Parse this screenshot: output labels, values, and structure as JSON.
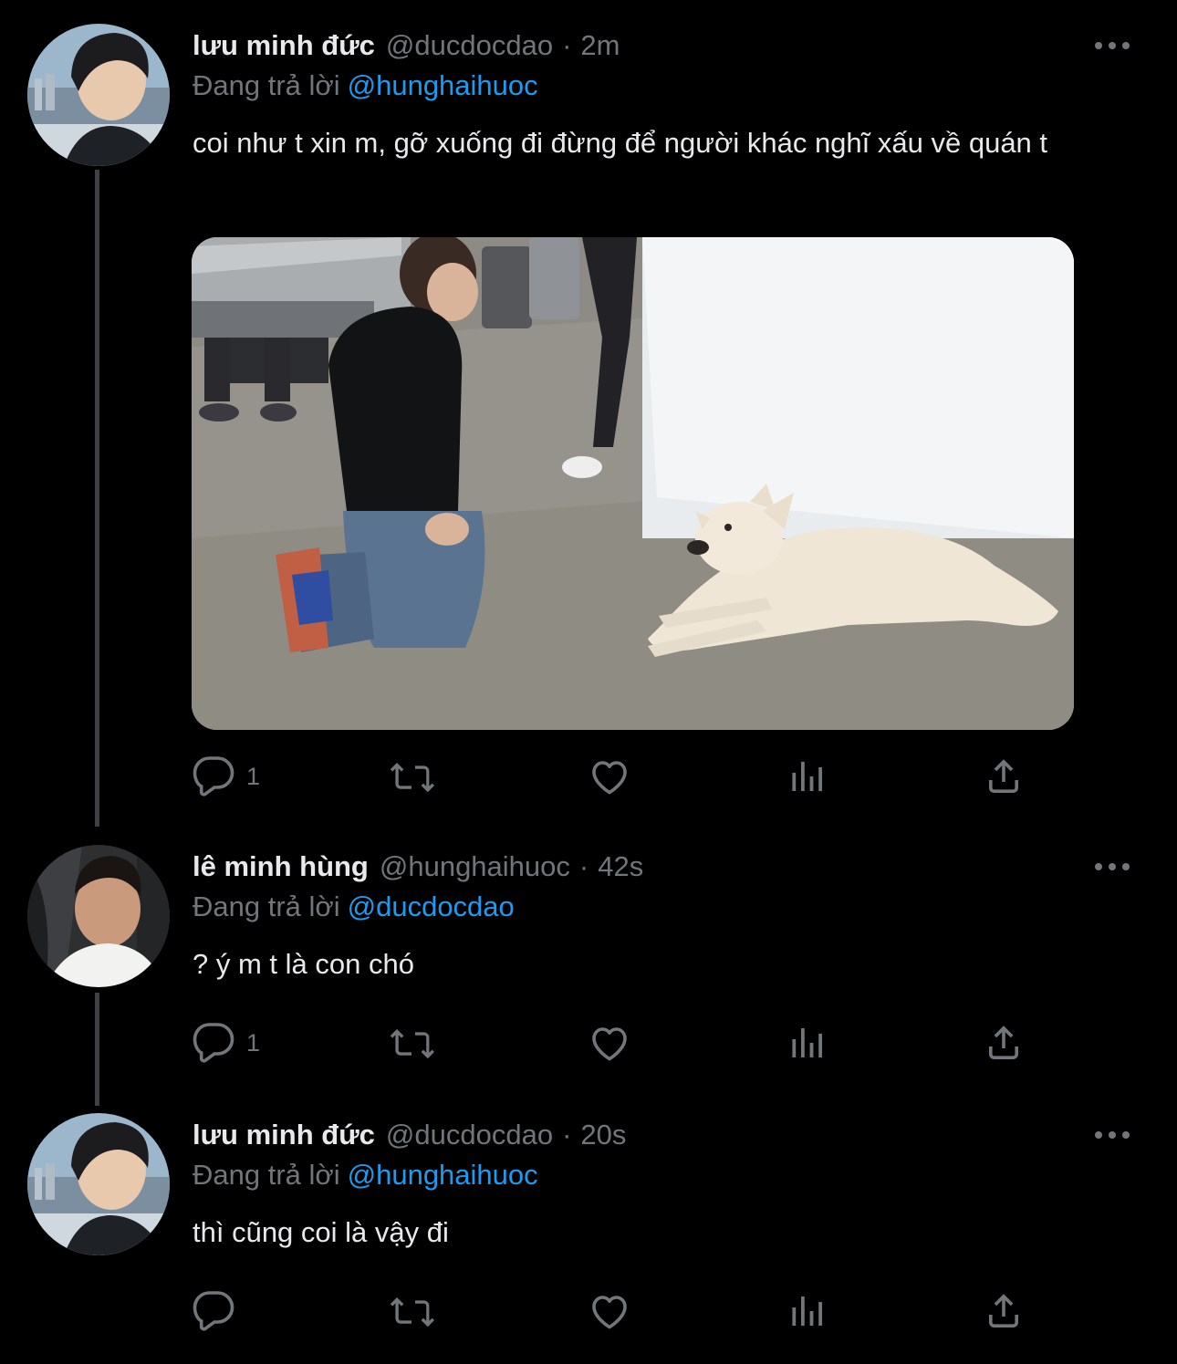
{
  "colors": {
    "background": "#000000",
    "text": "#e7e9ea",
    "muted": "#71767b",
    "link": "#1d9bf0",
    "thread_line": "#3e4144"
  },
  "tweets": [
    {
      "name": "lưu minh đức",
      "handle": "@ducdocdao",
      "separator": "·",
      "time": "2m",
      "replying_label": "Đang trả lời",
      "replying_to": "@hunghaihuoc",
      "text": "coi như t xin m, gỡ xuống đi đừng để người khác nghĩ xấu về quán t",
      "has_media": true,
      "reply_count": "1",
      "icons": [
        "reply-icon",
        "retweet-icon",
        "like-icon",
        "analytics-icon",
        "share-icon"
      ]
    },
    {
      "name": "lê minh hùng",
      "handle": "@hunghaihuoc",
      "separator": "·",
      "time": "42s",
      "replying_label": "Đang trả lời",
      "replying_to": "@ducdocdao",
      "text": "? ý m t là con chó",
      "has_media": false,
      "reply_count": "1",
      "icons": [
        "reply-icon",
        "retweet-icon",
        "like-icon",
        "analytics-icon",
        "share-icon"
      ]
    },
    {
      "name": "lưu minh đức",
      "handle": "@ducdocdao",
      "separator": "·",
      "time": "20s",
      "replying_label": "Đang trả lời",
      "replying_to": "@hunghaihuoc",
      "text": "thì cũng coi là vậy đi",
      "has_media": false,
      "reply_count": "",
      "icons": [
        "reply-icon",
        "retweet-icon",
        "like-icon",
        "analytics-icon",
        "share-icon"
      ]
    }
  ]
}
